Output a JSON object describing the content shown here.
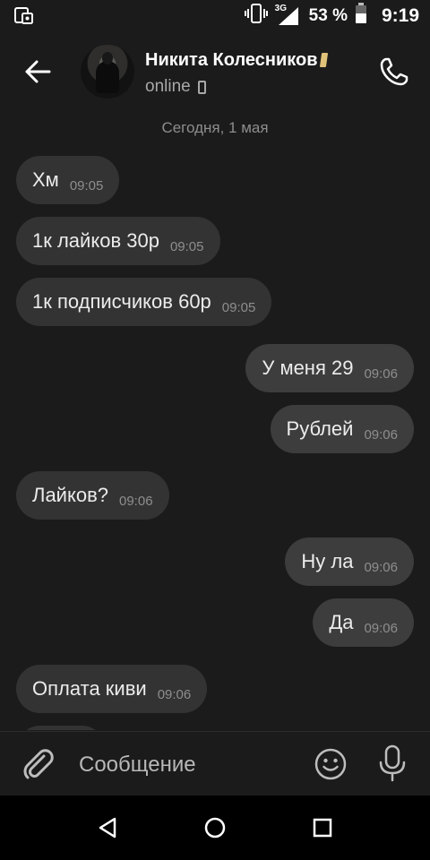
{
  "status_bar": {
    "network": "3G",
    "battery_pct": "53 %",
    "time": "9:19"
  },
  "header": {
    "name": "Никита Колесников",
    "status": "online"
  },
  "date_separator": "Сегодня, 1 мая",
  "messages": [
    {
      "text": "Хм",
      "time": "09:05",
      "direction": "in"
    },
    {
      "text": "1к лайков 30р",
      "time": "09:05",
      "direction": "in"
    },
    {
      "text": "1к подписчиков 60р",
      "time": "09:05",
      "direction": "in"
    },
    {
      "text": "У меня 29",
      "time": "09:06",
      "direction": "out"
    },
    {
      "text": "Рублей",
      "time": "09:06",
      "direction": "out"
    },
    {
      "text": "Лайков?",
      "time": "09:06",
      "direction": "in"
    },
    {
      "text": "Ну ла",
      "time": "09:06",
      "direction": "out"
    },
    {
      "text": "Да",
      "time": "09:06",
      "direction": "out"
    },
    {
      "text": "Оплата киви",
      "time": "09:06",
      "direction": "in"
    }
  ],
  "composer": {
    "placeholder": "Сообщение"
  },
  "colors": {
    "background": "#1b1b1b",
    "bubble_in": "#333333",
    "bubble_out": "#3d3d3d",
    "name_badge": "#e0c27a"
  }
}
